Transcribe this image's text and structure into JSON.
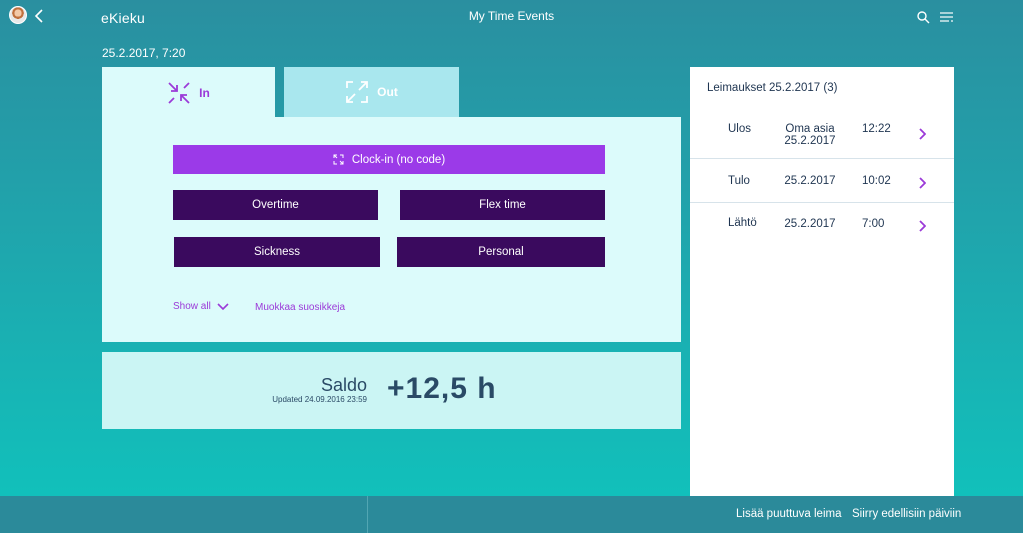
{
  "header": {
    "brand": "eKieku",
    "title": "My Time Events",
    "icons": [
      "avatar",
      "chevron-left-icon",
      "search-icon",
      "menu-icon"
    ]
  },
  "datetime": "25.2.2017, 7:20",
  "tabs": [
    {
      "label": "In",
      "active": true,
      "icon": "collapse-arrows-icon"
    },
    {
      "label": "Out",
      "active": false,
      "icon": "expand-arrows-icon"
    }
  ],
  "actions": {
    "clock_in": "Clock-in (no code)",
    "overtime": "Overtime",
    "flex_time": "Flex time",
    "sickness": "Sickness",
    "personal": "Personal",
    "show_all": "Show all",
    "edit_favorites": "Muokkaa suosikkeja"
  },
  "saldo": {
    "label": "Saldo",
    "updated": "Updated 24.09.2016 23:59",
    "value": "+12,5 h"
  },
  "stamps": {
    "heading": "Leimaukset 25.2.2017 (3)",
    "rows": [
      {
        "type": "Ulos",
        "desc_line1": "Oma asia",
        "desc_line2": "25.2.2017",
        "time": "12:22"
      },
      {
        "type": "Tulo",
        "desc_line1": "25.2.2017",
        "desc_line2": "",
        "time": "10:02"
      },
      {
        "type": "Lähtö",
        "desc_line1": "25.2.2017",
        "desc_line2": "",
        "time": "7:00"
      }
    ]
  },
  "footer": {
    "add_missing": "Lisää puuttuva leima",
    "prev_days": "Siirry edellisiin päiviin"
  },
  "colors": {
    "accent_purple": "#9b3ae8",
    "dark_purple": "#3a0a5e",
    "panel_bg": "#dcfbfb",
    "text_dark": "#2a4a66"
  }
}
